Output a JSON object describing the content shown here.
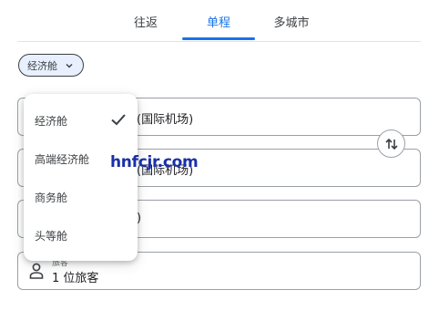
{
  "tabs": [
    {
      "label": "往返"
    },
    {
      "label": "单程"
    },
    {
      "label": "多城市"
    }
  ],
  "selected_tab": "单程",
  "class_chip": {
    "label": "经济舱",
    "icon": "chevron-down-icon"
  },
  "fields": {
    "origin_value": "(国际机场)",
    "destination_value": "(国际机场)",
    "date_partial": ")",
    "passengers_label": "旅客",
    "passengers_value": "1 位旅客"
  },
  "class_menu": {
    "items": [
      {
        "label": "经济舱",
        "selected": true
      },
      {
        "label": "高端经济舱",
        "selected": false
      },
      {
        "label": "商务舱",
        "selected": false
      },
      {
        "label": "头等舱",
        "selected": false
      }
    ]
  },
  "watermark": "hnfcjr.com",
  "colors": {
    "accent": "#1a73e8",
    "chip_bg": "#e8f0fe",
    "border": "#9aa0a6"
  }
}
